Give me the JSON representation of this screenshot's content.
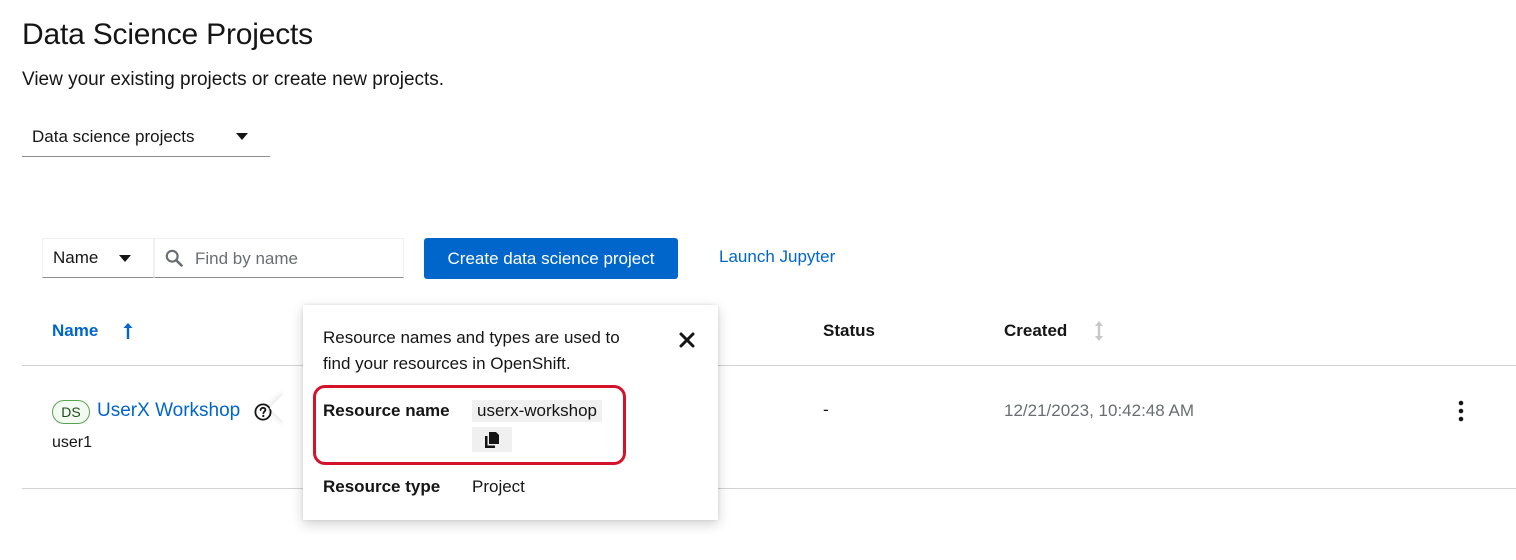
{
  "header": {
    "title": "Data Science Projects",
    "subtitle": "View your existing projects or create new projects."
  },
  "project_selector": {
    "selected": "Data science projects"
  },
  "toolbar": {
    "filter_selected": "Name",
    "search_placeholder": "Find by name",
    "search_value": "",
    "create_button_label": "Create data science project",
    "launch_link_label": "Launch Jupyter"
  },
  "table": {
    "columns": [
      "Name",
      "Status",
      "Created"
    ],
    "sort": {
      "column": "Name",
      "direction": "ascending"
    },
    "rows": [
      {
        "badge": "DS",
        "name": "UserX Workshop",
        "owner": "user1",
        "status": "-",
        "created": "12/21/2023, 10:42:48 AM"
      }
    ]
  },
  "popover": {
    "description": "Resource names and types are used to find your resources in OpenShift.",
    "resource_name_label": "Resource name",
    "resource_name_value": "userx-workshop",
    "resource_type_label": "Resource type",
    "resource_type_value": "Project"
  },
  "colors": {
    "primary": "#0066cc",
    "highlight_border": "#d4132a",
    "badge_border": "#5ba352"
  },
  "icons": [
    "chevron-down-icon",
    "search-icon",
    "sort-ascending-icon",
    "sort-icon",
    "help-icon",
    "close-icon",
    "copy-icon",
    "kebab-menu-icon"
  ]
}
